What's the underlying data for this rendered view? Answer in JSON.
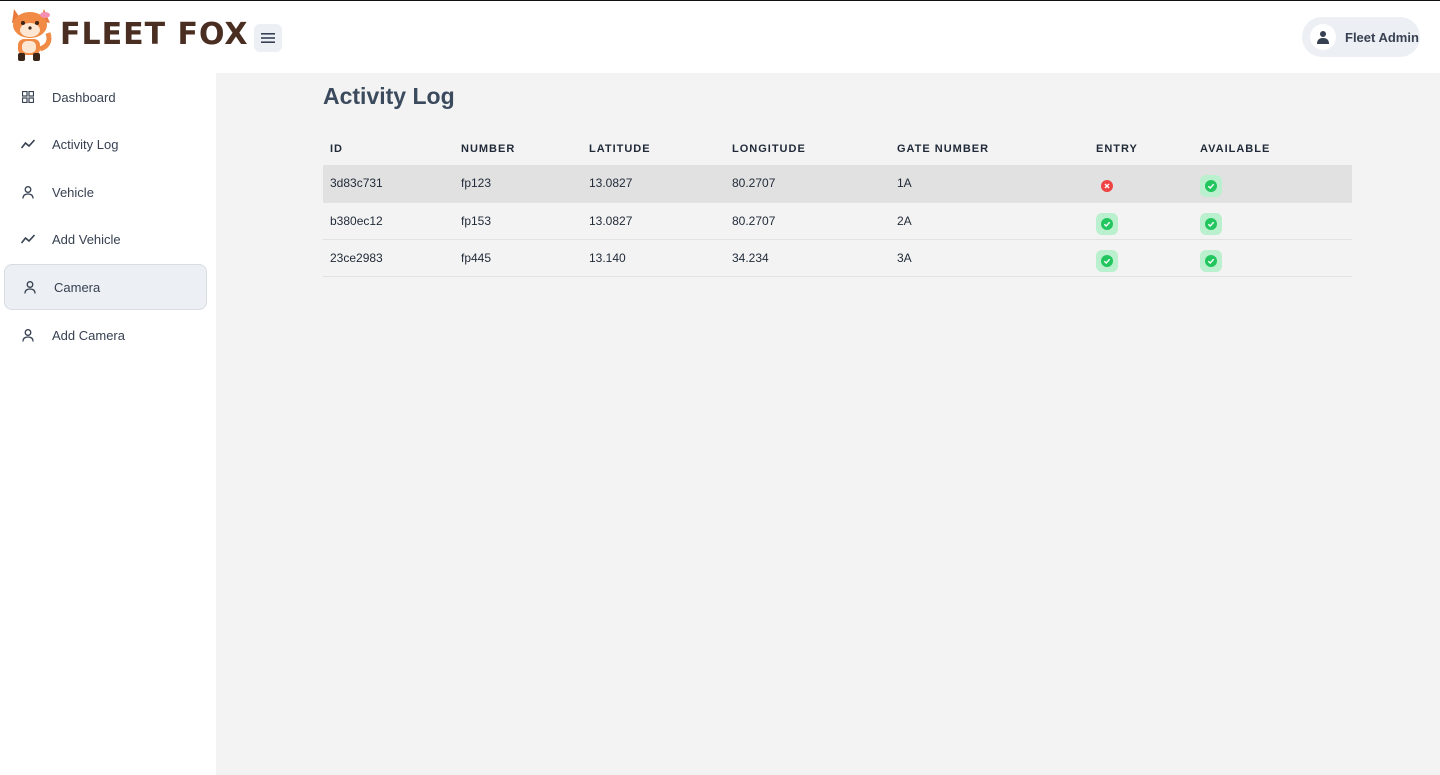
{
  "app": {
    "brand": "FLEET FOX"
  },
  "header": {
    "user_name": "Fleet Admin"
  },
  "sidebar": {
    "items": [
      {
        "label": "Dashboard",
        "icon": "grid-icon",
        "active": false
      },
      {
        "label": "Activity Log",
        "icon": "trend-icon",
        "active": false
      },
      {
        "label": "Vehicle",
        "icon": "user-icon",
        "active": false
      },
      {
        "label": "Add Vehicle",
        "icon": "trend-icon",
        "active": false
      },
      {
        "label": "Camera",
        "icon": "user-icon",
        "active": true
      },
      {
        "label": "Add Camera",
        "icon": "user-icon",
        "active": false
      }
    ]
  },
  "main": {
    "title": "Activity Log",
    "columns": [
      "ID",
      "NUMBER",
      "LATITUDE",
      "LONGITUDE",
      "GATE NUMBER",
      "ENTRY",
      "AVAILABLE"
    ],
    "rows": [
      {
        "id": "3d83c731",
        "number": "fp123",
        "latitude": "13.0827",
        "longitude": "80.2707",
        "gate": "1A",
        "entry": false,
        "available": true
      },
      {
        "id": "b380ec12",
        "number": "fp153",
        "latitude": "13.0827",
        "longitude": "80.2707",
        "gate": "2A",
        "entry": true,
        "available": true
      },
      {
        "id": "23ce2983",
        "number": "fp445",
        "latitude": "13.140",
        "longitude": "34.234",
        "gate": "3A",
        "entry": true,
        "available": true
      }
    ]
  },
  "colors": {
    "success": "#22c55e",
    "danger": "#ef4444",
    "main_bg": "#f3f3f3"
  }
}
